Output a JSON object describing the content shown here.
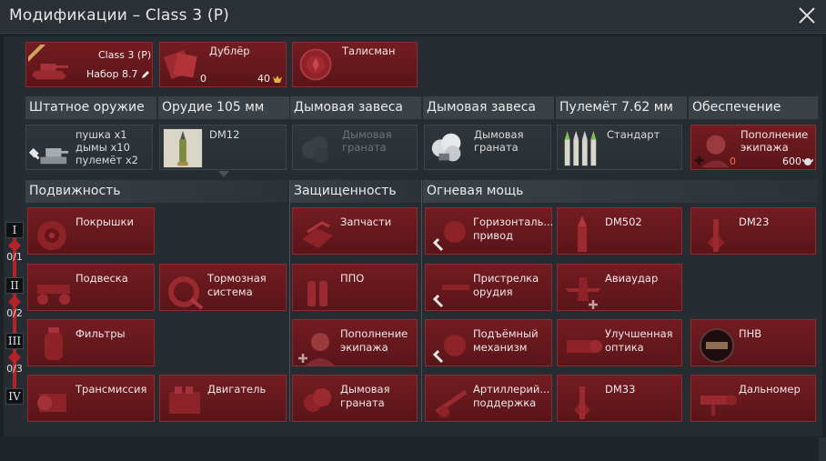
{
  "window": {
    "title": "Модификации – Class 3 (P)"
  },
  "top_cards": {
    "vehicle": {
      "name": "Class 3 (P)",
      "preset": "Набор 8.7",
      "edit_icon": "pencil-icon"
    },
    "backup": {
      "label": "Дублёр",
      "count": "0",
      "cost": "40",
      "currency_icon": "golden-eagle-icon"
    },
    "talisman": {
      "label": "Талисман"
    }
  },
  "categories": {
    "standard": "Штатное оружие",
    "cannon": "Орудие 105 мм",
    "smoke1": "Дымовая завеса",
    "smoke2": "Дымовая завеса",
    "mg": "Пулемёт 7.62 мм",
    "support": "Обеспечение"
  },
  "weapons": {
    "standard": [
      "пушка x1",
      "дымы x10",
      "пулемёт x2"
    ],
    "cannon": "DM12",
    "smoke1": [
      "Дымовая",
      "граната"
    ],
    "smoke2": [
      "Дымовая",
      "граната"
    ],
    "mg": "Стандарт",
    "support": {
      "line1": "Пополнение",
      "line2": "экипажа",
      "count": "0",
      "cost": "600",
      "currency_icon": "silver-lion-icon"
    }
  },
  "sections": {
    "mobility": "Подвижность",
    "protection": "Защищенность",
    "firepower": "Огневая мощь"
  },
  "tiers": [
    {
      "label": "I",
      "progress": "0/1"
    },
    {
      "label": "II",
      "progress": "0/2"
    },
    {
      "label": "III",
      "progress": "0/3"
    },
    {
      "label": "IV"
    }
  ],
  "mods": {
    "tires": "Покрышки",
    "suspension": "Подвеска",
    "brakes": [
      "Тормозная",
      "система"
    ],
    "filters": "Фильтры",
    "transmission": "Трансмиссия",
    "engine": "Двигатель",
    "parts": "Запчасти",
    "fire_protection": "ППО",
    "crew_replenish": [
      "Пополнение",
      "экипажа"
    ],
    "smoke_grenade": [
      "Дымовая",
      "граната"
    ],
    "horizontal_drive": [
      "Горизонталь...",
      "привод"
    ],
    "adjustment": [
      "Пристрелка",
      "орудия"
    ],
    "elevation": [
      "Подъёмный",
      "механизм"
    ],
    "artillery": [
      "Артиллерий...",
      "поддержка"
    ],
    "dm502": "DM502",
    "airstrike": "Авиаудар",
    "optics": [
      "Улучшенная",
      "оптика"
    ],
    "dm33": "DM33",
    "dm23": "DM23",
    "nvd": "ПНВ",
    "rangefinder": "Дальномер"
  },
  "colors": {
    "accent_red": "#7a1d22",
    "header_gray": "#3a4147",
    "background": "#1d2227"
  }
}
